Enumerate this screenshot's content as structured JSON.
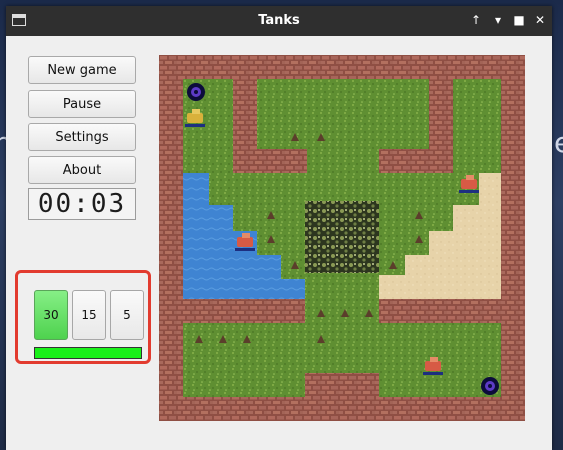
{
  "window": {
    "title": "Tanks",
    "controls": [
      "up-icon",
      "minimize-icon",
      "maximize-icon",
      "close-icon"
    ]
  },
  "menu": {
    "new_game": "New game",
    "pause": "Pause",
    "settings": "Settings",
    "about": "About"
  },
  "timer": "00:03",
  "stats": {
    "first": "30",
    "second": "15",
    "third": "5",
    "active_index": 0,
    "health_fraction": 1.0
  },
  "colors": {
    "brick": "#9a5a4c",
    "grass": "#5f8f32",
    "water": "#3f84d2",
    "sand": "#e7d3a9",
    "forest": "#2f3a20",
    "health": "#19f019"
  }
}
